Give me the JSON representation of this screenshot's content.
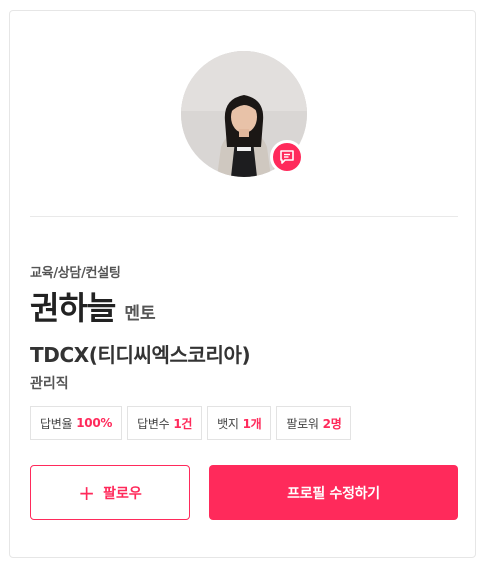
{
  "profile": {
    "category": "교육/상담/컨설팅",
    "name": "권하늘",
    "role": "멘토",
    "company": "TDCX(티디씨엑스코리아)",
    "job": "관리직",
    "avatar_icon": "profile-photo",
    "message_icon": "message-icon"
  },
  "stats": [
    {
      "label": "답변율",
      "value": "100%"
    },
    {
      "label": "답변수",
      "value": "1건"
    },
    {
      "label": "뱃지",
      "value": "1개"
    },
    {
      "label": "팔로워",
      "value": "2명"
    }
  ],
  "actions": {
    "follow_icon": "plus-icon",
    "follow_label": "팔로우",
    "edit_label": "프로필 수정하기"
  },
  "colors": {
    "accent": "#ff2a5b",
    "border": "#e6e6e6",
    "text": "#222222"
  }
}
